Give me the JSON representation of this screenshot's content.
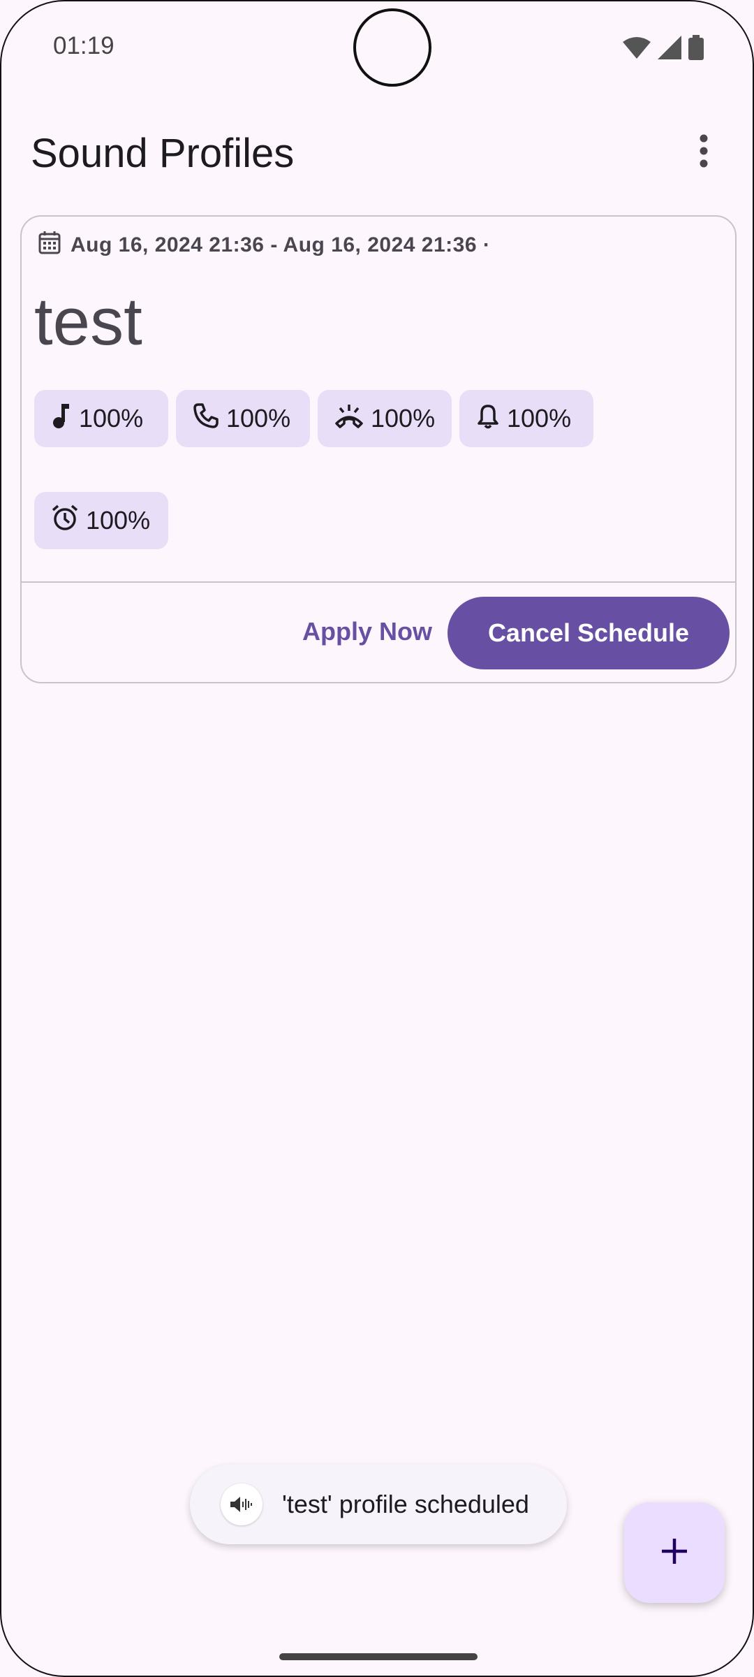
{
  "status_bar": {
    "time": "01:19",
    "icons": [
      "wifi-icon",
      "cell-signal-icon",
      "battery-icon"
    ]
  },
  "app_bar": {
    "title": "Sound Profiles",
    "menu_icon": "more-vert-icon"
  },
  "profile_card": {
    "schedule": "Aug 16, 2024 21:36 - Aug 16, 2024 21:36 ·",
    "name": "test",
    "volumes": [
      {
        "icon": "music-note-icon",
        "value": "100%"
      },
      {
        "icon": "phone-icon",
        "value": "100%"
      },
      {
        "icon": "ringtone-icon",
        "value": "100%"
      },
      {
        "icon": "bell-icon",
        "value": "100%"
      },
      {
        "icon": "alarm-icon",
        "value": "100%"
      }
    ],
    "apply_label": "Apply Now",
    "cancel_label": "Cancel Schedule"
  },
  "snackbar": {
    "icon": "sound-profile-icon",
    "message": "'test' profile scheduled"
  },
  "fab": {
    "icon": "plus-icon"
  },
  "colors": {
    "background": "#fdf6fc",
    "primary": "#6750a4",
    "chip": "#e8def8",
    "fab": "#eaddff"
  }
}
